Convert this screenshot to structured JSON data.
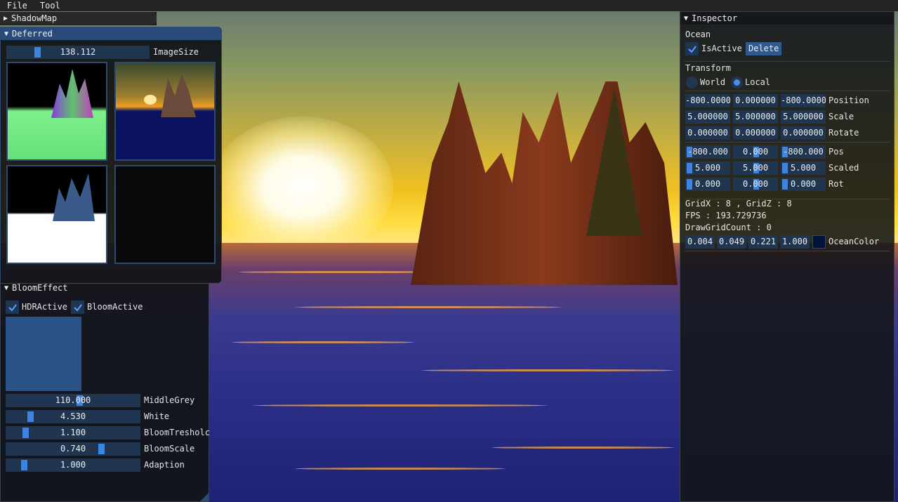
{
  "menubar": {
    "items": [
      "File",
      "Tool"
    ]
  },
  "shadowmap": {
    "title": "ShadowMap"
  },
  "deferred": {
    "title": "Deferred",
    "image_size": {
      "value": "138.112",
      "label": "ImageSize",
      "fraction": 0.22
    }
  },
  "bloom": {
    "title": "BloomEffect",
    "hdr_label": "HDRActive",
    "bloom_label": "BloomActive",
    "sliders": [
      {
        "value": "110.000",
        "label": "MiddleGrey",
        "fraction": 0.55
      },
      {
        "value": "4.530",
        "label": "White",
        "fraction": 0.17
      },
      {
        "value": "1.100",
        "label": "BloomTresholc",
        "fraction": 0.13
      },
      {
        "value": "0.740",
        "label": "BloomScale",
        "fraction": 0.72
      },
      {
        "value": "1.000",
        "label": "Adaption",
        "fraction": 0.12
      }
    ]
  },
  "inspector": {
    "title": "Inspector",
    "object_name": "Ocean",
    "isactive_label": "IsActive",
    "delete_label": "Delete",
    "transform_label": "Transform",
    "world_label": "World",
    "local_label": "Local",
    "transform_rows": [
      {
        "values": [
          "-800.0000",
          "0.000000",
          "-800.0000"
        ],
        "label": "Position"
      },
      {
        "values": [
          "5.000000",
          "5.000000",
          "5.000000"
        ],
        "label": "Scale"
      },
      {
        "values": [
          "0.000000",
          "0.000000",
          "0.000000"
        ],
        "label": "Rotate"
      }
    ],
    "drag_rows": [
      {
        "values": [
          "-800.000",
          "0.000",
          "-800.000"
        ],
        "label": "Pos"
      },
      {
        "values": [
          "5.000",
          "5.000",
          "5.000"
        ],
        "label": "Scaled"
      },
      {
        "values": [
          "0.000",
          "0.000",
          "0.000"
        ],
        "label": "Rot"
      }
    ],
    "grid_text": "GridX : 8 , GridZ : 8",
    "fps_text": "FPS : 193.729736",
    "drawgrid_text": "DrawGridCount : 0",
    "ocean_color": {
      "values": [
        "0.004",
        "0.049",
        "0.221",
        "1.000"
      ],
      "label": "OceanColor",
      "swatch": "#01123a"
    }
  },
  "colors": {
    "accent": "#3d85e0",
    "frame_bg": "#1f3550",
    "title_active": "#2a4a7a"
  }
}
